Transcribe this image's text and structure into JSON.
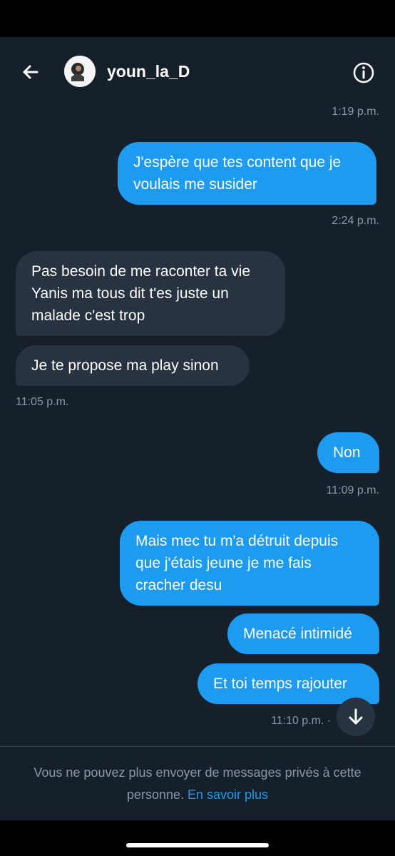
{
  "header": {
    "username": "youn_la_D"
  },
  "messages": [
    {
      "type": "timestamp",
      "text": "1:19 p.m."
    },
    {
      "type": "outgoing",
      "text": "J'espère que tes content que je voulais me susider"
    },
    {
      "type": "timestamp",
      "text": "2:24 p.m."
    },
    {
      "type": "incoming",
      "text": "Pas besoin de me raconter ta vie Yanis ma tous dit t'es juste un malade c'est trop"
    },
    {
      "type": "incoming",
      "text": "Je te propose ma play sinon"
    },
    {
      "type": "timestamp",
      "text": "11:05 p.m."
    },
    {
      "type": "outgoing",
      "text": "Non"
    },
    {
      "type": "timestamp",
      "text": "11:09 p.m."
    },
    {
      "type": "outgoing",
      "text": "Mais mec tu m'a détruit depuis que j'étais jeune je me fais cracher desu"
    },
    {
      "type": "outgoing",
      "text": "Menacé intimidé"
    },
    {
      "type": "outgoing",
      "text": "Et toi temps rajouter"
    },
    {
      "type": "timestamp",
      "text": "11:10 p.m. ·"
    }
  ],
  "footer": {
    "text": "Vous ne pouvez plus envoyer de messages privés à cette personne.",
    "link": "En savoir plus"
  },
  "icons": {
    "back": "arrow-left-icon",
    "info": "info-icon",
    "scroll": "arrow-down-icon"
  },
  "colors": {
    "background": "#15202b",
    "outgoing_bubble": "#1d9bf0",
    "incoming_bubble": "#273340",
    "muted_text": "#8b98a5",
    "link": "#1d9bf0"
  }
}
